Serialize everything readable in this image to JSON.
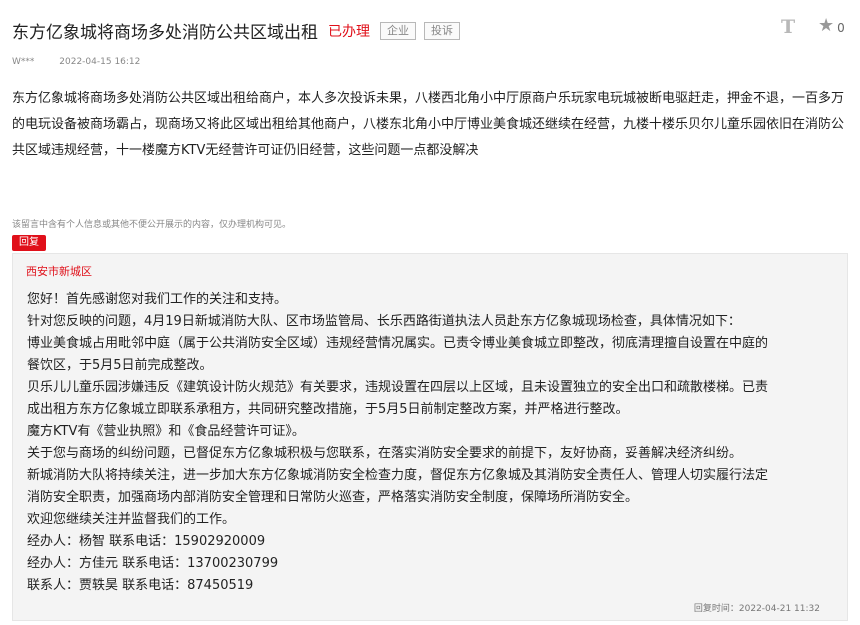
{
  "header": {
    "title": "东方亿象城将商场多处消防公共区域出租",
    "status": "已办理",
    "tags": [
      "企业",
      "投诉"
    ],
    "font_icon_glyph": "T",
    "like_count": "0",
    "icons": {
      "font_size": "font-size-icon",
      "like": "star-icon"
    }
  },
  "meta": {
    "author": "W***",
    "time": "2022-04-15 16:12"
  },
  "content": "东方亿象城将商场多处消防公共区域出租给商户，本人多次投诉未果，八楼西北角小中厅原商户乐玩家电玩城被断电驱赶走，押金不退，一百多万的电玩设备被商场霸占，现商场又将此区域出租给其他商户，八楼东北角小中厅博业美食城还继续在经营，九楼十楼乐贝尔儿童乐园依旧在消防公共区域违规经营，十一楼魔方KTV无经营许可证仍旧经营，这些问题一点都没解决",
  "notice": "该留言中含有个人信息或其他不便公开展示的内容，仅办理机构可见。",
  "reply": {
    "badge": "回复",
    "department": "西安市新城区",
    "lines": [
      "您好！首先感谢您对我们工作的关注和支持。",
      " 针对您反映的问题，4月19日新城消防大队、区市场监管局、长乐西路街道执法人员赴东方亿象城现场检查，具体情况如下：",
      " 博业美食城占用毗邻中庭（属于公共消防安全区域）违规经营情况属实。已责令博业美食城立即整改，彻底清理擅自设置在中庭的",
      "餐饮区，于5月5日前完成整改。",
      " 贝乐儿儿童乐园涉嫌违反《建筑设计防火规范》有关要求，违规设置在四层以上区域，且未设置独立的安全出口和疏散楼梯。已责",
      "成出租方东方亿象城立即联系承租方，共同研究整改措施，于5月5日前制定整改方案，并严格进行整改。",
      " 魔方KTV有《营业执照》和《食品经营许可证》。",
      " 关于您与商场的纠纷问题，已督促东方亿象城积极与您联系，在落实消防安全要求的前提下，友好协商，妥善解决经济纠纷。",
      " 新城消防大队将持续关注，进一步加大东方亿象城消防安全检查力度，督促东方亿象城及其消防安全责任人、管理人切实履行法定",
      "消防安全职责，加强商场内部消防安全管理和日常防火巡查，严格落实消防安全制度，保障场所消防安全。",
      " 欢迎您继续关注并监督我们的工作。",
      " 经办人：杨智 联系电话：15902920009",
      " 经办人：方佳元 联系电话：13700230799",
      " 联系人：贾轶昊 联系电话：87450519"
    ],
    "time": "回复时间：2022-04-21 11:32"
  }
}
